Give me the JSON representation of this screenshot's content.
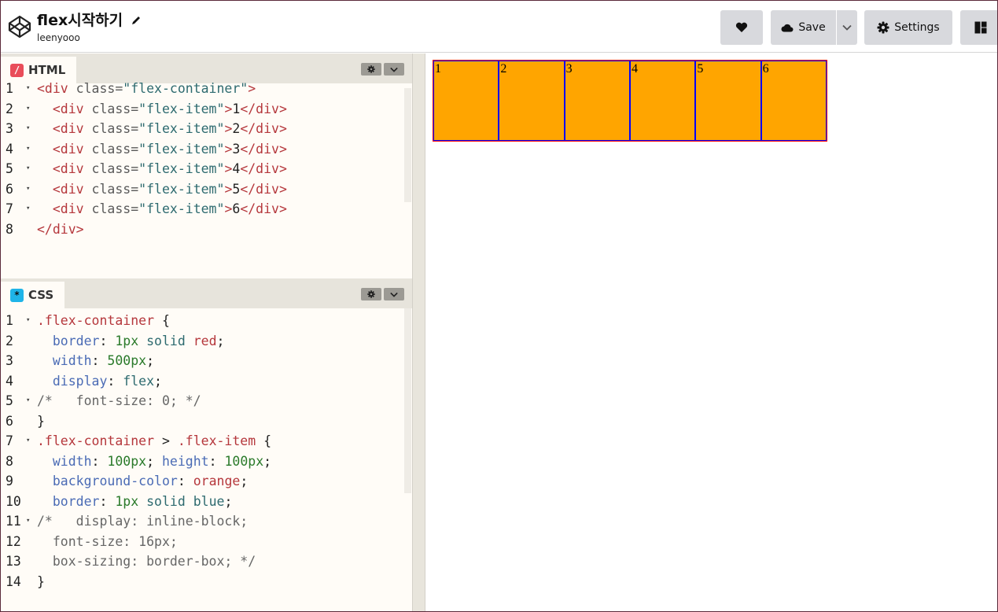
{
  "header": {
    "title": "flex시작하기",
    "author": "leenyooo",
    "save_label": "Save",
    "settings_label": "Settings"
  },
  "html_pane": {
    "label": "HTML",
    "icon": "/",
    "lines": [
      {
        "n": "1",
        "fold": true,
        "parts": [
          [
            "tag",
            "<div "
          ],
          [
            "attr",
            "class="
          ],
          [
            "str",
            "\"flex-container\""
          ],
          [
            "tag",
            ">"
          ]
        ]
      },
      {
        "n": "2",
        "fold": true,
        "parts": [
          [
            "plain",
            "  "
          ],
          [
            "tag",
            "<div "
          ],
          [
            "attr",
            "class="
          ],
          [
            "str",
            "\"flex-item\""
          ],
          [
            "tag",
            ">"
          ],
          [
            "plain",
            "1"
          ],
          [
            "tag",
            "</div>"
          ]
        ]
      },
      {
        "n": "3",
        "fold": true,
        "parts": [
          [
            "plain",
            "  "
          ],
          [
            "tag",
            "<div "
          ],
          [
            "attr",
            "class="
          ],
          [
            "str",
            "\"flex-item\""
          ],
          [
            "tag",
            ">"
          ],
          [
            "plain",
            "2"
          ],
          [
            "tag",
            "</div>"
          ]
        ]
      },
      {
        "n": "4",
        "fold": true,
        "parts": [
          [
            "plain",
            "  "
          ],
          [
            "tag",
            "<div "
          ],
          [
            "attr",
            "class="
          ],
          [
            "str",
            "\"flex-item\""
          ],
          [
            "tag",
            ">"
          ],
          [
            "plain",
            "3"
          ],
          [
            "tag",
            "</div>"
          ]
        ]
      },
      {
        "n": "5",
        "fold": true,
        "parts": [
          [
            "plain",
            "  "
          ],
          [
            "tag",
            "<div "
          ],
          [
            "attr",
            "class="
          ],
          [
            "str",
            "\"flex-item\""
          ],
          [
            "tag",
            ">"
          ],
          [
            "plain",
            "4"
          ],
          [
            "tag",
            "</div>"
          ]
        ]
      },
      {
        "n": "6",
        "fold": true,
        "parts": [
          [
            "plain",
            "  "
          ],
          [
            "tag",
            "<div "
          ],
          [
            "attr",
            "class="
          ],
          [
            "str",
            "\"flex-item\""
          ],
          [
            "tag",
            ">"
          ],
          [
            "plain",
            "5"
          ],
          [
            "tag",
            "</div>"
          ]
        ]
      },
      {
        "n": "7",
        "fold": true,
        "parts": [
          [
            "plain",
            "  "
          ],
          [
            "tag",
            "<div "
          ],
          [
            "attr",
            "class="
          ],
          [
            "str",
            "\"flex-item\""
          ],
          [
            "tag",
            ">"
          ],
          [
            "plain",
            "6"
          ],
          [
            "tag",
            "</div>"
          ]
        ]
      },
      {
        "n": "8",
        "fold": false,
        "parts": [
          [
            "tag",
            "</div>"
          ]
        ]
      }
    ]
  },
  "css_pane": {
    "label": "CSS",
    "icon": "*",
    "lines": [
      {
        "n": "1",
        "fold": true,
        "parts": [
          [
            "sel",
            ".flex-container"
          ],
          [
            "plain",
            " {"
          ]
        ]
      },
      {
        "n": "2",
        "fold": false,
        "parts": [
          [
            "plain",
            "  "
          ],
          [
            "prop",
            "border"
          ],
          [
            "plain",
            ": "
          ],
          [
            "num",
            "1px"
          ],
          [
            "plain",
            " "
          ],
          [
            "val",
            "solid"
          ],
          [
            "plain",
            " "
          ],
          [
            "red",
            "red"
          ],
          [
            "plain",
            ";"
          ]
        ]
      },
      {
        "n": "3",
        "fold": false,
        "parts": [
          [
            "plain",
            "  "
          ],
          [
            "prop",
            "width"
          ],
          [
            "plain",
            ": "
          ],
          [
            "num",
            "500px"
          ],
          [
            "plain",
            ";"
          ]
        ]
      },
      {
        "n": "4",
        "fold": false,
        "parts": [
          [
            "plain",
            "  "
          ],
          [
            "prop",
            "display"
          ],
          [
            "plain",
            ": "
          ],
          [
            "val",
            "flex"
          ],
          [
            "plain",
            ";"
          ]
        ]
      },
      {
        "n": "5",
        "fold": true,
        "parts": [
          [
            "com",
            "/*   font-size: 0; */"
          ]
        ]
      },
      {
        "n": "6",
        "fold": false,
        "parts": [
          [
            "plain",
            "}"
          ]
        ]
      },
      {
        "n": "7",
        "fold": true,
        "parts": [
          [
            "sel",
            ".flex-container"
          ],
          [
            "plain",
            " > "
          ],
          [
            "sel",
            ".flex-item"
          ],
          [
            "plain",
            " {"
          ]
        ]
      },
      {
        "n": "8",
        "fold": false,
        "parts": [
          [
            "plain",
            "  "
          ],
          [
            "prop",
            "width"
          ],
          [
            "plain",
            ": "
          ],
          [
            "num",
            "100px"
          ],
          [
            "plain",
            "; "
          ],
          [
            "prop",
            "height"
          ],
          [
            "plain",
            ": "
          ],
          [
            "num",
            "100px"
          ],
          [
            "plain",
            ";"
          ]
        ]
      },
      {
        "n": "9",
        "fold": false,
        "parts": [
          [
            "plain",
            "  "
          ],
          [
            "prop",
            "background-color"
          ],
          [
            "plain",
            ": "
          ],
          [
            "red",
            "orange"
          ],
          [
            "plain",
            ";"
          ]
        ]
      },
      {
        "n": "10",
        "fold": false,
        "parts": [
          [
            "plain",
            "  "
          ],
          [
            "prop",
            "border"
          ],
          [
            "plain",
            ": "
          ],
          [
            "num",
            "1px"
          ],
          [
            "plain",
            " "
          ],
          [
            "val",
            "solid"
          ],
          [
            "plain",
            " "
          ],
          [
            "val",
            "blue"
          ],
          [
            "plain",
            ";"
          ]
        ]
      },
      {
        "n": "11",
        "fold": true,
        "parts": [
          [
            "com",
            "/*   display: inline-block;"
          ]
        ]
      },
      {
        "n": "12",
        "fold": false,
        "parts": [
          [
            "com",
            "  font-size: 16px;"
          ]
        ]
      },
      {
        "n": "13",
        "fold": false,
        "parts": [
          [
            "com",
            "  box-sizing: border-box; */"
          ]
        ]
      },
      {
        "n": "14",
        "fold": false,
        "parts": [
          [
            "plain",
            "}"
          ]
        ]
      }
    ]
  },
  "preview": {
    "items": [
      "1",
      "2",
      "3",
      "4",
      "5",
      "6"
    ],
    "colors": {
      "item_bg": "#ffa500",
      "item_border": "#0000ff",
      "container_border": "#ff0000"
    }
  }
}
